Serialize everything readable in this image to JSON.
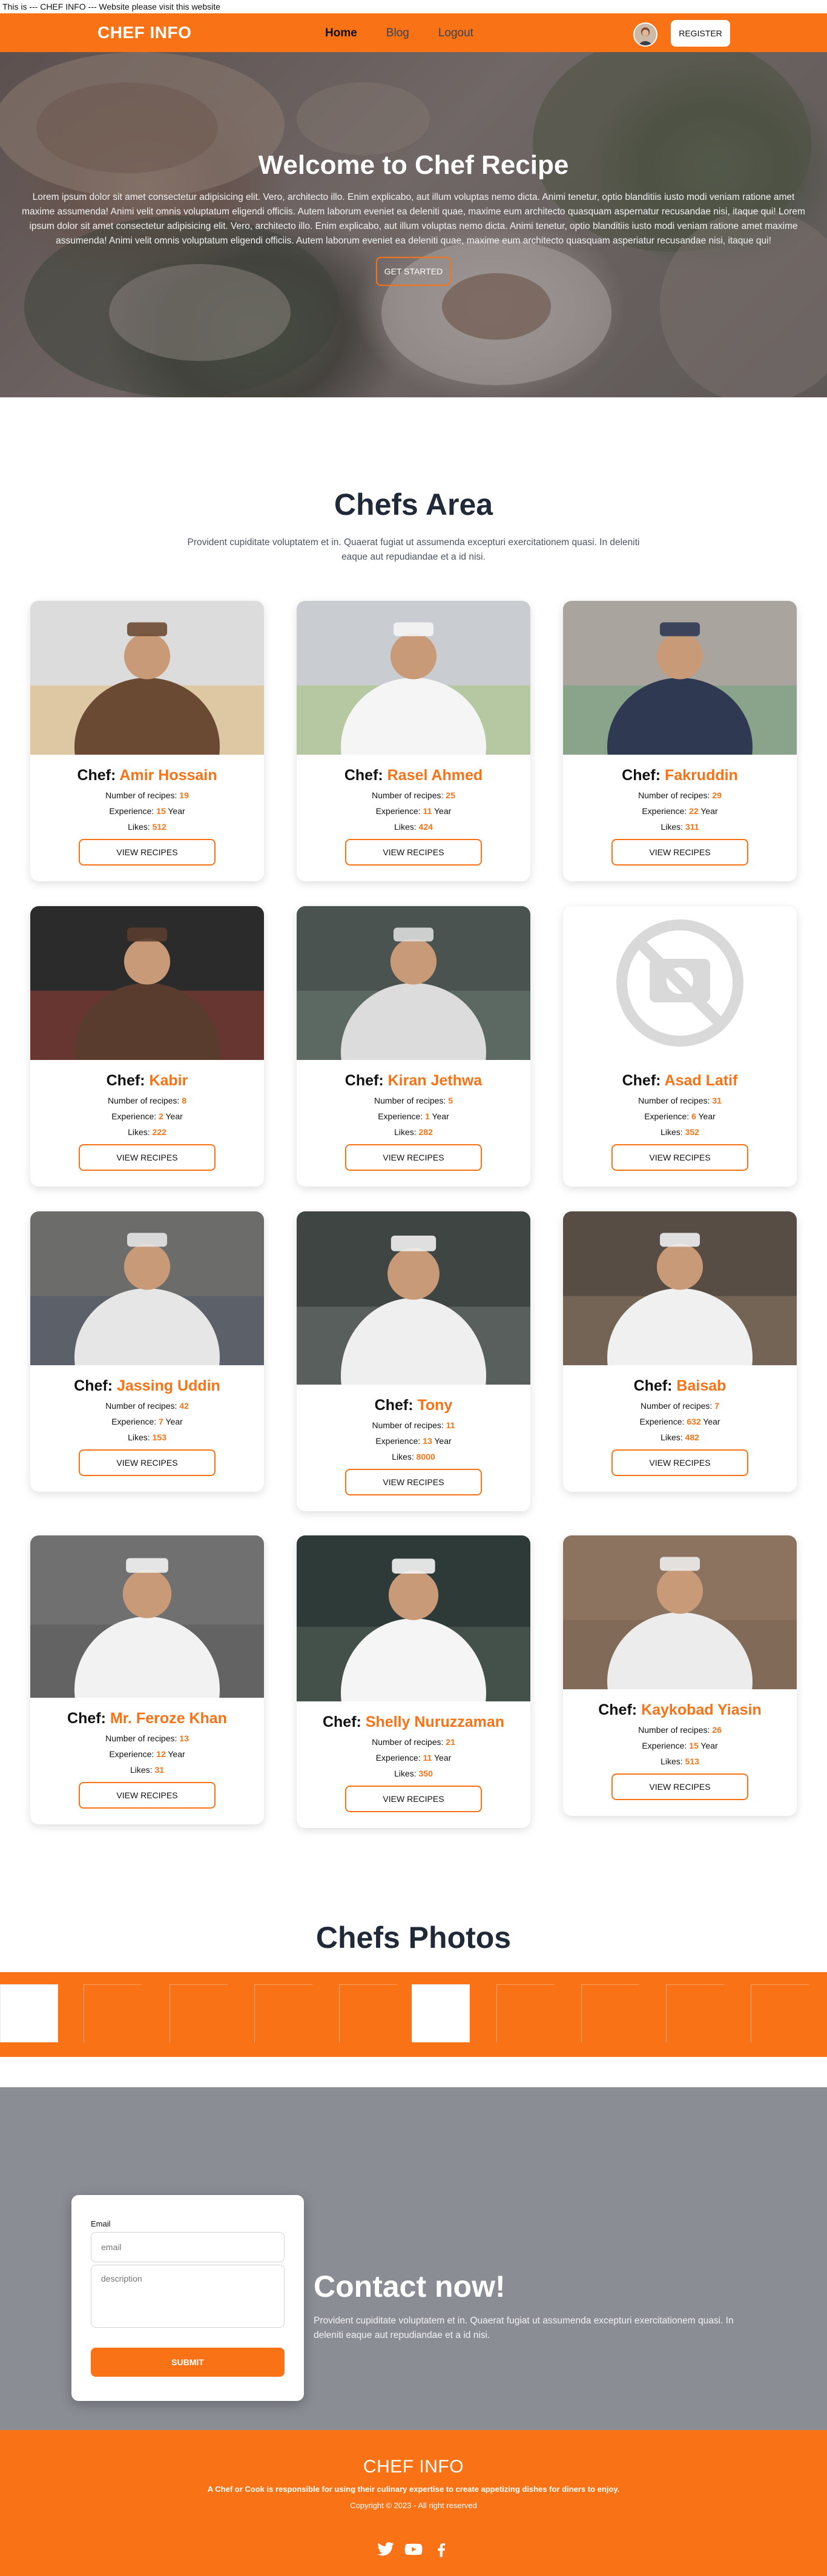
{
  "notice": "This is --- CHEF INFO --- Website please visit this website",
  "navbar": {
    "brand": "CHEF INFO",
    "links": [
      "Home",
      "Blog",
      "Logout"
    ],
    "register_label": "REGISTER",
    "colors": {
      "primary": "#f97316"
    }
  },
  "hero": {
    "title": "Welcome to Chef Recipe",
    "text": "Lorem ipsum dolor sit amet consectetur adipisicing elit. Vero, architecto illo. Enim explicabo, aut illum voluptas nemo dicta. Animi tenetur, optio blanditiis iusto modi veniam ratione amet maxime assumenda! Animi velit omnis voluptatum eligendi officiis. Autem laborum eveniet ea deleniti quae, maxime eum architecto quasquam aspernatur recusandae nisi, itaque qui! Lorem ipsum dolor sit amet consectetur adipisicing elit. Vero, architecto illo. Enim explicabo, aut illum voluptas nemo dicta. Animi tenetur, optio blanditiis iusto modi veniam ratione amet maxime assumenda! Animi velit omnis voluptatum eligendi officiis. Autem laborum eveniet ea deleniti quae, maxime eum architecto quasquam asperiatur recusandae nisi, itaque qui!",
    "button": "GET STARTED"
  },
  "chefs": {
    "title": "Chefs Area",
    "description": "Provident cupiditate voluptatem et in. Quaerat fugiat ut assumenda excepturi exercitationem quasi. In deleniti eaque aut repudiandae et a id nisi.",
    "chef_prefix": "Chef: ",
    "labels": {
      "recipes": "Number of recipes: ",
      "experience": "Experience: ",
      "year": " Year",
      "likes": "Likes: "
    },
    "button": "VIEW RECIPES",
    "items": [
      {
        "name": "Amir Hossain",
        "recipes": "19",
        "experience": "15",
        "likes": "512"
      },
      {
        "name": "Rasel Ahmed",
        "recipes": "25",
        "experience": "11",
        "likes": "424"
      },
      {
        "name": "Fakruddin",
        "recipes": "29",
        "experience": "22",
        "likes": "311"
      },
      {
        "name": "Kabir",
        "recipes": "8",
        "experience": "2",
        "likes": "222"
      },
      {
        "name": "Kiran Jethwa",
        "recipes": "5",
        "experience": "1",
        "likes": "282"
      },
      {
        "name": "Asad Latif",
        "recipes": "31",
        "experience": "6",
        "likes": "352"
      },
      {
        "name": "Jassing Uddin",
        "recipes": "42",
        "experience": "7",
        "likes": "153"
      },
      {
        "name": "Tony",
        "recipes": "11",
        "experience": "13",
        "likes": "8000"
      },
      {
        "name": "Baisab",
        "recipes": "7",
        "experience": "632",
        "likes": "482"
      },
      {
        "name": "Mr. Feroze Khan",
        "recipes": "13",
        "experience": "12",
        "likes": "31"
      },
      {
        "name": "Shelly Nuruzzaman",
        "recipes": "21",
        "experience": "11",
        "likes": "350"
      },
      {
        "name": "Kaykobad Yiasin",
        "recipes": "26",
        "experience": "15",
        "likes": "513"
      }
    ]
  },
  "photos": {
    "title": "Chefs Photos"
  },
  "contact": {
    "email_label": "Email",
    "email_placeholder": "email",
    "description_placeholder": "description",
    "submit": "SUBMIT",
    "title": "Contact now!",
    "text": "Provident cupiditate voluptatem et in. Quaerat fugiat ut assumenda excepturi exercitationem quasi. In deleniti eaque aut repudiandae et a id nisi."
  },
  "footer": {
    "brand": "CHEF INFO",
    "about": "A Chef or Cook is responsible for using their culinary expertise to create appetizing dishes for diners to enjoy.",
    "copyright": "Copyright © 2023 - All right reserved",
    "socials": [
      "twitter-icon",
      "youtube-icon",
      "facebook-icon"
    ]
  }
}
